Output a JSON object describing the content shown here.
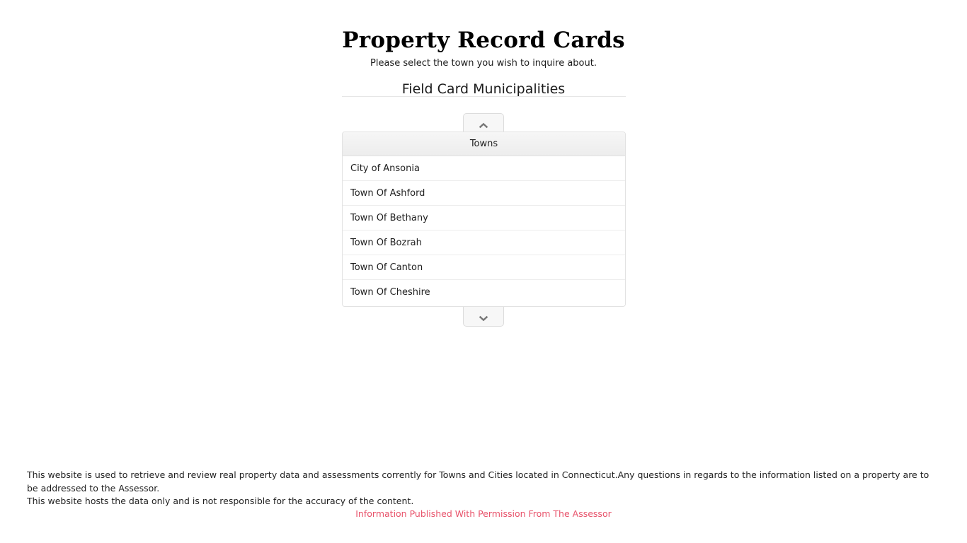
{
  "header": {
    "title": "Property Record Cards",
    "subtitle": "Please select the town you wish to inquire about.",
    "section_heading": "Field Card Municipalities"
  },
  "pager": {
    "up_icon": "chevron-up-icon",
    "down_icon": "chevron-down-icon"
  },
  "towns_table": {
    "column_header": "Towns",
    "rows": [
      "City of Ansonia",
      "Town Of Ashford",
      "Town Of Bethany",
      "Town Of Bozrah",
      "Town Of Canton",
      "Town Of Cheshire"
    ]
  },
  "footer": {
    "line1": "This website is used to retrieve and review real property data and assessments corrently for Towns and Cities located in Connecticut.Any questions in regards to the information listed on a property are to be addressed to the Assessor.",
    "line2": "This website hosts the data only and is not responsible for the accuracy of the content.",
    "permission": "Information Published With Permission From The Assessor"
  },
  "colors": {
    "permission_text": "#e8536b",
    "header_gradient_top": "#f6f6f6",
    "header_gradient_bottom": "#ededed",
    "border": "#e2e2e2",
    "text": "#1f1f1f"
  }
}
